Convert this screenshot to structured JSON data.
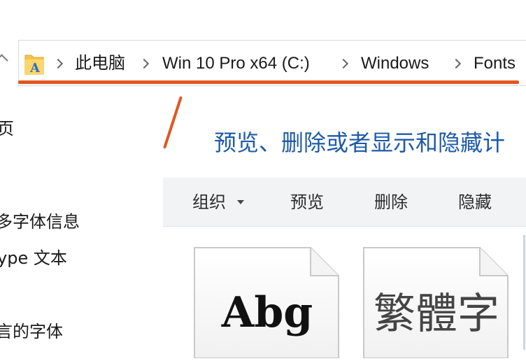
{
  "address_bar": {
    "crumbs": [
      "此电脑",
      "Win 10 Pro x64 (C:)",
      "Windows",
      "Fonts"
    ]
  },
  "sidebar": {
    "items": [
      "页",
      "多字体信息",
      "ype 文本",
      "言的字体"
    ]
  },
  "main": {
    "heading": "预览、删除或者显示和隐藏计"
  },
  "toolbar": {
    "organize_label": "组织",
    "preview_label": "预览",
    "delete_label": "删除",
    "hide_label": "隐藏"
  },
  "font_tiles": [
    {
      "sample": "Abg"
    },
    {
      "sample": "繁體字"
    }
  ],
  "colors": {
    "accent_underline": "#e2561f",
    "heading": "#1e5aa8",
    "toolbar_bg": "#f2f3f5"
  },
  "icons": [
    "up-arrow-icon",
    "fonts-folder-icon",
    "chevron-right-icon",
    "dropdown-caret-icon",
    "font-file-icon"
  ]
}
